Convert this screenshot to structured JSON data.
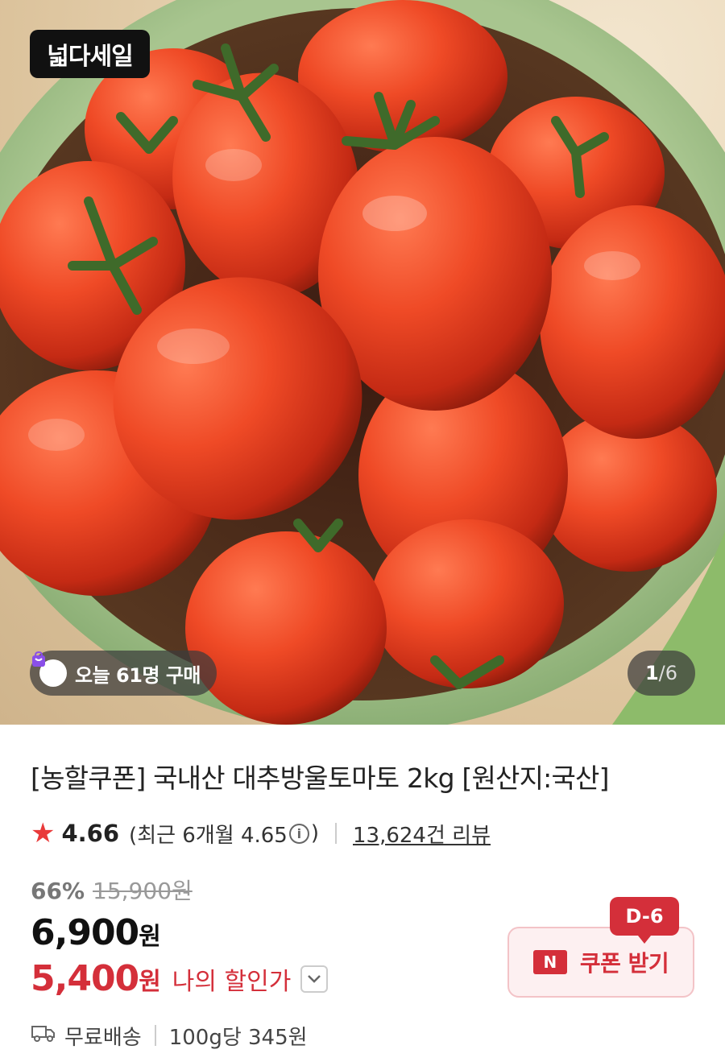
{
  "hero": {
    "sale_logo": "넓다세일",
    "buyers_text": "오늘 61명 구매",
    "page_current": "1",
    "page_total": "/6"
  },
  "product": {
    "title": "[농할쿠폰] 국내산 대추방울토마토 2kg [원산지:국산]",
    "rating": "4.66",
    "recent_rating_prefix": "(최근 6개월 4.65",
    "recent_rating_suffix": ")",
    "review_count": "13,624건 리뷰",
    "discount_rate": "66%",
    "original_price": "15,900원",
    "price_number": "6,900",
    "price_unit": "원",
    "my_price_number": "5,400",
    "my_price_unit": "원",
    "my_price_label": "나의 할인가",
    "coupon_badge": "N",
    "coupon_label": "쿠폰 받기",
    "dday": "D-6",
    "shipping": "무료배송",
    "unit_price": "100g당 345원"
  },
  "colors": {
    "accent_red": "#d42f3a",
    "star": "#e93a3a"
  },
  "icons": {
    "rating": "star-icon",
    "info": "info-icon",
    "dropdown": "chevron-down-icon",
    "shipping": "truck-icon",
    "buyers": "shopping-bag-icon"
  }
}
